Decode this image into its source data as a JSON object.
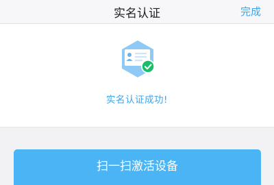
{
  "navbar": {
    "title": "实名认证",
    "done_label": "完成"
  },
  "result": {
    "icon": "id-card-verified-icon",
    "message": "实名认证成功!"
  },
  "action": {
    "label": "扫一扫激活设备"
  },
  "colors": {
    "accent": "#3ea5ea",
    "button": "#4bb4f4",
    "success": "#19be6b",
    "badge": "#8fc9f5"
  }
}
